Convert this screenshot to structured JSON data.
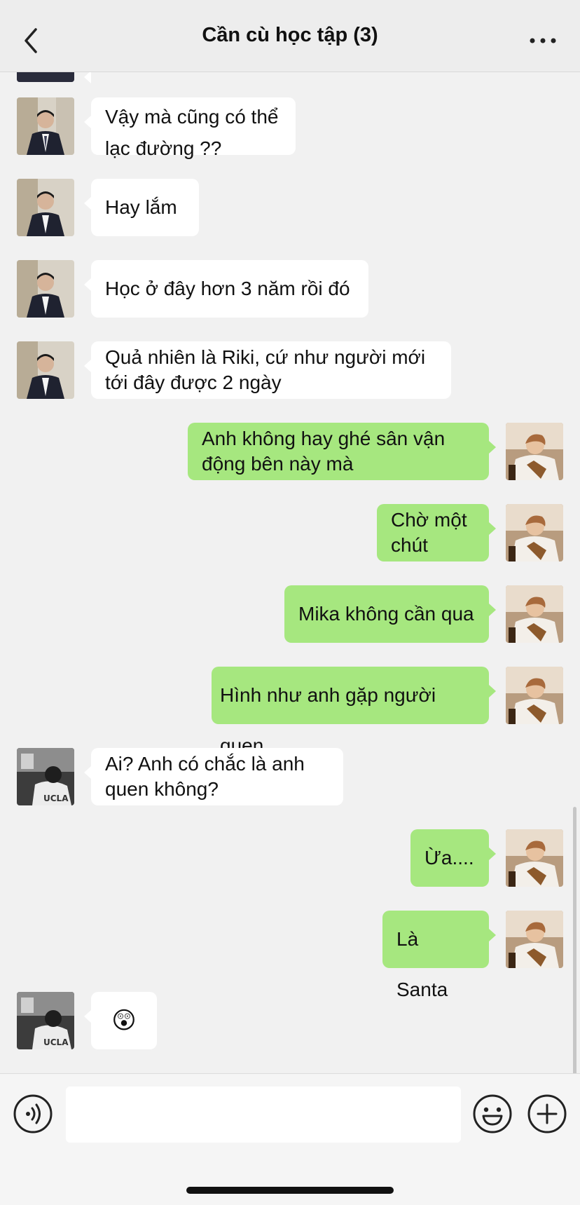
{
  "header": {
    "title": "Cần cù học tập (3)"
  },
  "icons": {
    "back": "chevron-left-icon",
    "more": "ellipsis-icon",
    "voice": "voice-icon",
    "emoji": "emoji-icon",
    "plus": "plus-icon"
  },
  "avatars": {
    "suit_man": "avatar-man-in-suit",
    "bw_person": "avatar-black-white-person",
    "me": "avatar-me"
  },
  "colors": {
    "incoming_bubble": "#ffffff",
    "outgoing_bubble": "#a6e77f",
    "background": "#f1f1f1"
  },
  "messages": [
    {
      "side": "in",
      "sender_avatar": "suit_man",
      "text": "Vậy mà cũng có thể lạc đường ??"
    },
    {
      "side": "in",
      "sender_avatar": "suit_man",
      "text": "Hay lắm"
    },
    {
      "side": "in",
      "sender_avatar": "suit_man",
      "text": "Học ở đây hơn 3 năm rồi đó"
    },
    {
      "side": "in",
      "sender_avatar": "suit_man",
      "text": "Quả nhiên là Riki, cứ như người mới tới đây được 2 ngày"
    },
    {
      "side": "out",
      "sender_avatar": "me",
      "text": "Anh không hay ghé sân vận động bên này mà"
    },
    {
      "side": "out",
      "sender_avatar": "me",
      "text": "Chờ một chút"
    },
    {
      "side": "out",
      "sender_avatar": "me",
      "text": "Mika không cần qua"
    },
    {
      "side": "out",
      "sender_avatar": "me",
      "text": "Hình như anh gặp người quen"
    },
    {
      "side": "in",
      "sender_avatar": "bw_person",
      "text": "Ai? Anh có chắc là anh quen không?"
    },
    {
      "side": "out",
      "sender_avatar": "me",
      "text": "Ừa......"
    },
    {
      "side": "out",
      "sender_avatar": "me",
      "text": "Là Santa"
    },
    {
      "side": "in",
      "sender_avatar": "bw_person",
      "text": "😲"
    }
  ],
  "input": {
    "value": "",
    "placeholder": ""
  }
}
